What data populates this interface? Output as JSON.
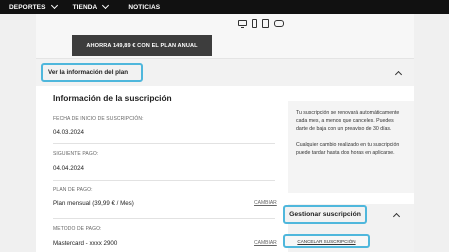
{
  "nav": {
    "items": [
      {
        "label": "DEPORTES",
        "has_dropdown": true
      },
      {
        "label": "TIENDA",
        "has_dropdown": true
      },
      {
        "label": "NOTICIAS",
        "has_dropdown": false
      }
    ]
  },
  "plan_banner": {
    "annual_button": "AHORRA 149,89 € CON EL PLAN ANUAL",
    "device_icons": [
      "tv-icon",
      "phone-icon",
      "tablet-icon",
      "gamepad-icon"
    ]
  },
  "plan_info": {
    "toggle_label": "Ver la información del plan",
    "expanded": true
  },
  "subscription": {
    "title": "Información de la suscripción",
    "start_date_label": "FECHA DE INICIO DE SUSCRIPCIÓN:",
    "start_date_value": "04.03.2024",
    "next_payment_label": "SIGUIENTE PAGO:",
    "next_payment_value": "04.04.2024",
    "plan_label": "PLAN DE PAGO:",
    "plan_value": "Plan mensual (39,99 € / Mes)",
    "plan_change_link": "CAMBIAR",
    "payment_method_label": "METODO DE PAGO:",
    "payment_method_value": "Mastercard - xxxx 2900",
    "payment_change_link": "CAMBIAR"
  },
  "side_info": {
    "renewal_text": "Tu suscripción se renovará automáticamente cada mes, a menos que canceles. Puedes darte de baja con un preaviso de 30 días.",
    "changes_text": "Cualquier cambio realizado en tu suscripción puede tardar hasta dos horas en aplicarse."
  },
  "manage": {
    "button_label": "Gestionar suscripción",
    "cancel_link": "CANCELAR SUSCRIPCIÓN"
  },
  "colors": {
    "highlight": "#4fb7dc",
    "nav_bg": "#111111",
    "button_bg": "#3d3d3d"
  }
}
